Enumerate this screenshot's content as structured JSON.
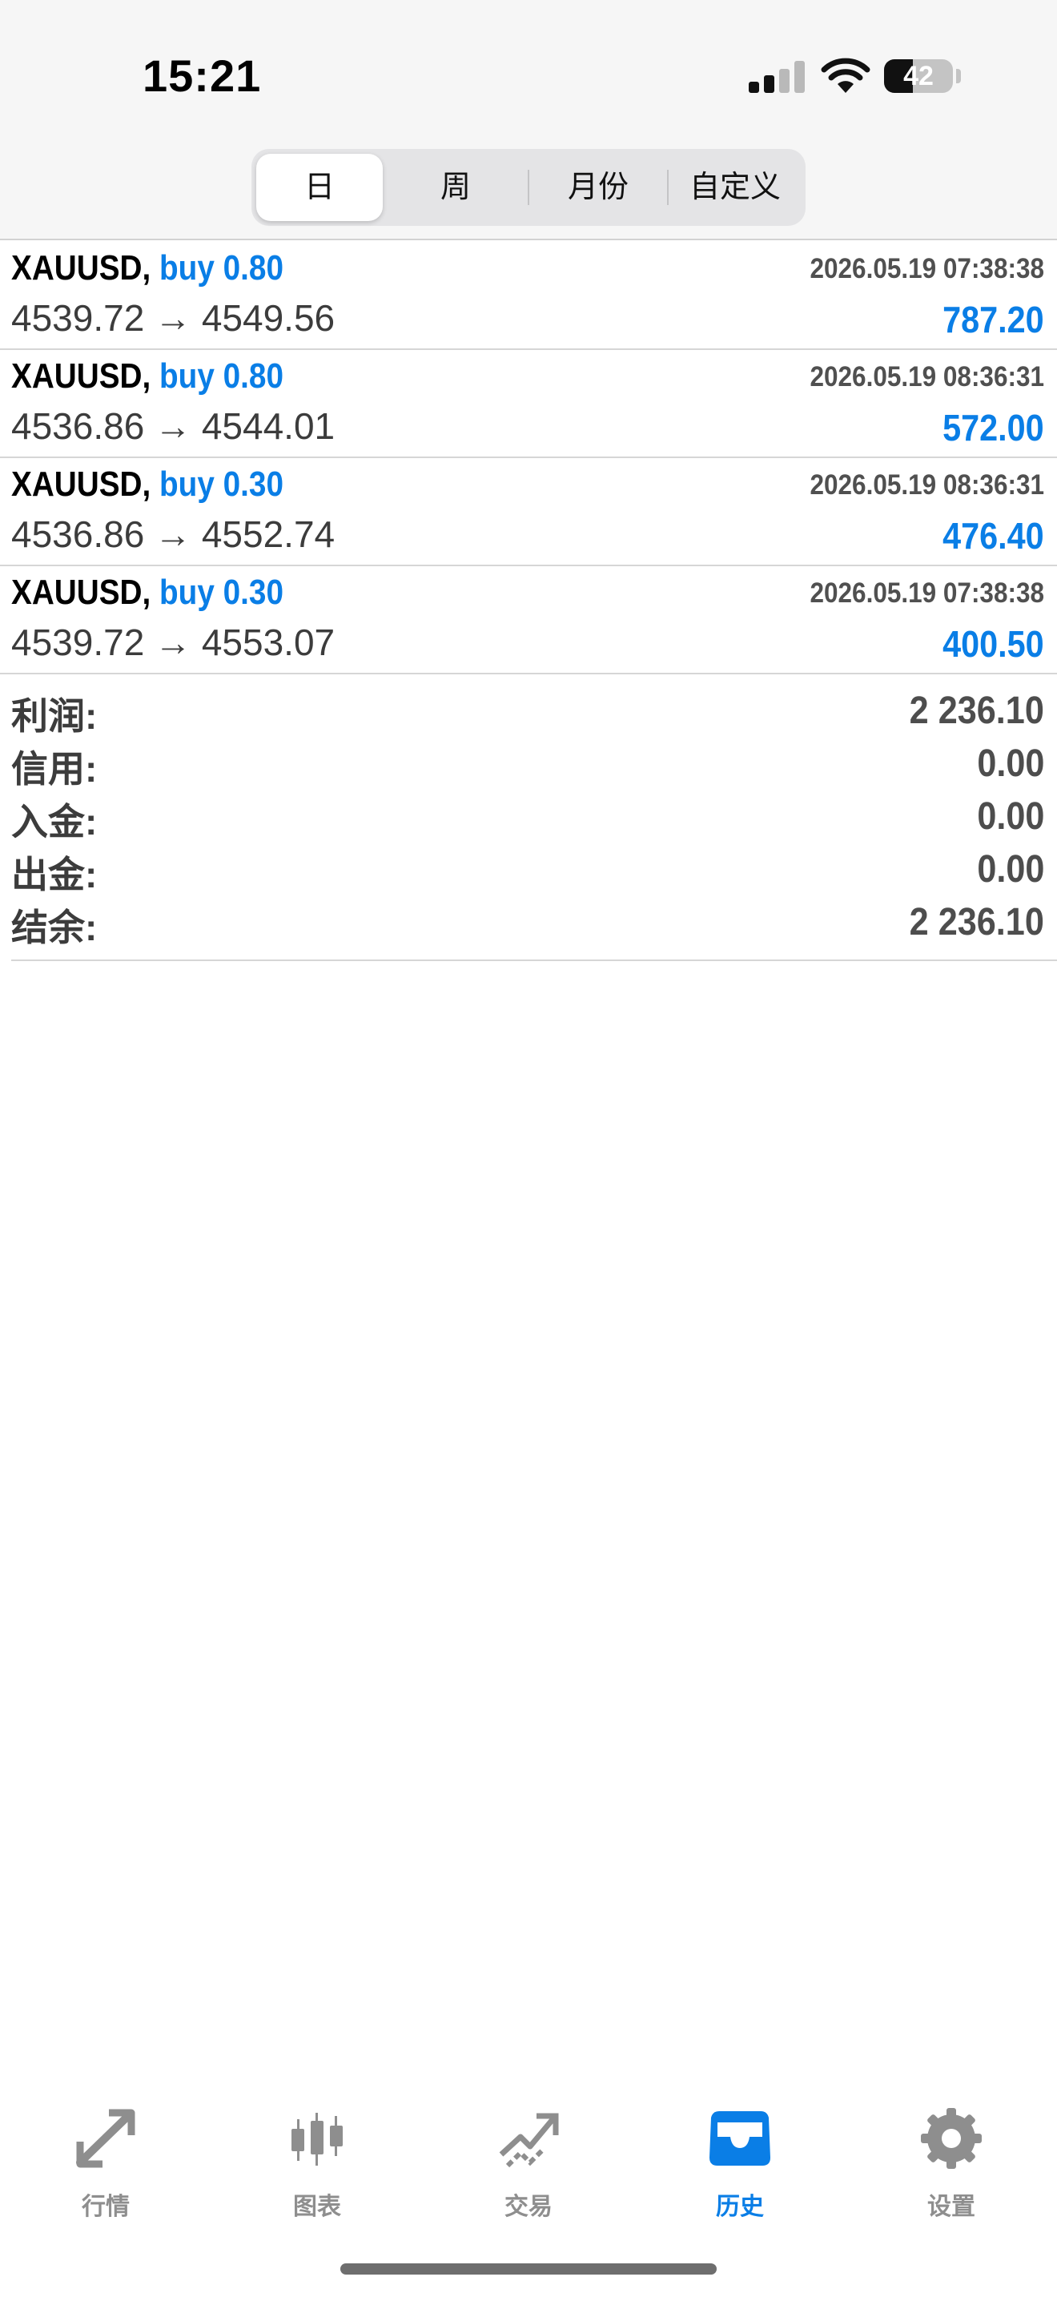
{
  "status_bar": {
    "time": "15:21",
    "battery": "42",
    "battery_level": 0.42
  },
  "tabs_period": {
    "items": [
      {
        "label": "日",
        "active": true
      },
      {
        "label": "周",
        "active": false
      },
      {
        "label": "月份",
        "active": false
      },
      {
        "label": "自定义",
        "active": false
      }
    ]
  },
  "trades": [
    {
      "symbol": "XAUUSD,",
      "side": "buy 0.80",
      "time": "2026.05.19 07:38:38",
      "prices": "4539.72 → 4549.56",
      "profit": "787.20"
    },
    {
      "symbol": "XAUUSD,",
      "side": "buy 0.80",
      "time": "2026.05.19 08:36:31",
      "prices": "4536.86 → 4544.01",
      "profit": "572.00"
    },
    {
      "symbol": "XAUUSD,",
      "side": "buy 0.30",
      "time": "2026.05.19 08:36:31",
      "prices": "4536.86 → 4552.74",
      "profit": "476.40"
    },
    {
      "symbol": "XAUUSD,",
      "side": "buy 0.30",
      "time": "2026.05.19 07:38:38",
      "prices": "4539.72 → 4553.07",
      "profit": "400.50"
    }
  ],
  "summary": [
    {
      "label": "利润:",
      "value": "2 236.10"
    },
    {
      "label": "信用:",
      "value": "0.00"
    },
    {
      "label": "入金:",
      "value": "0.00"
    },
    {
      "label": "出金:",
      "value": "0.00"
    },
    {
      "label": "结余:",
      "value": "2 236.10"
    }
  ],
  "tabbar": {
    "items": [
      {
        "label": "行情",
        "icon": "quotes-icon",
        "active": false
      },
      {
        "label": "图表",
        "icon": "chart-icon",
        "active": false
      },
      {
        "label": "交易",
        "icon": "trade-icon",
        "active": false
      },
      {
        "label": "历史",
        "icon": "history-icon",
        "active": true
      },
      {
        "label": "设置",
        "icon": "settings-icon",
        "active": false
      }
    ]
  },
  "colors": {
    "accent": "#0a7ee6",
    "inactive": "#8e8e8e",
    "header_bg": "#f6f6f6"
  }
}
